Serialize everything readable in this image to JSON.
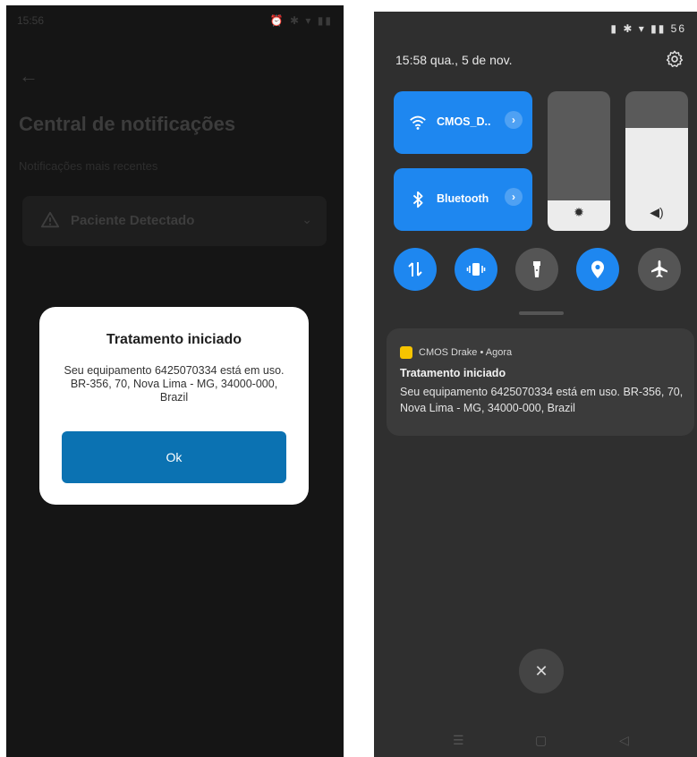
{
  "left_screen": {
    "status_time": "15:56",
    "back_icon": "arrow-left-icon",
    "page_title": "Central de notificações",
    "section_label": "Notificações mais recentes",
    "notification_card": {
      "title": "Paciente Detectado",
      "icon": "warning-icon"
    },
    "dialog": {
      "title": "Tratamento iniciado",
      "message": "Seu equipamento 6425070334 está em uso. BR-356, 70, Nova Lima - MG, 34000-000, Brazil",
      "ok_label": "Ok",
      "button_color": "#0b72b2"
    }
  },
  "right_screen": {
    "battery": "56",
    "clock": "15:58 qua., 5 de nov.",
    "tiles": [
      {
        "label": "CMOS_D..",
        "icon": "wifi-icon"
      },
      {
        "label": "Bluetooth",
        "icon": "bluetooth-icon"
      }
    ],
    "sliders": [
      {
        "icon": "brightness-icon",
        "level": 0.22
      },
      {
        "icon": "volume-icon",
        "level": 0.74
      }
    ],
    "toggles": [
      {
        "icon": "mobile-data-icon",
        "on": true
      },
      {
        "icon": "vibrate-icon",
        "on": true
      },
      {
        "icon": "flashlight-icon",
        "on": false
      },
      {
        "icon": "location-icon",
        "on": true
      },
      {
        "icon": "airplane-icon",
        "on": false
      }
    ],
    "notification": {
      "app": "CMOS Drake • Agora",
      "title": "Tratamento iniciado",
      "body": "Seu equipamento 6425070334 está em uso. BR-356, 70, Nova Lima - MG, 34000-000, Brazil"
    },
    "accent_color": "#1e87f0"
  }
}
